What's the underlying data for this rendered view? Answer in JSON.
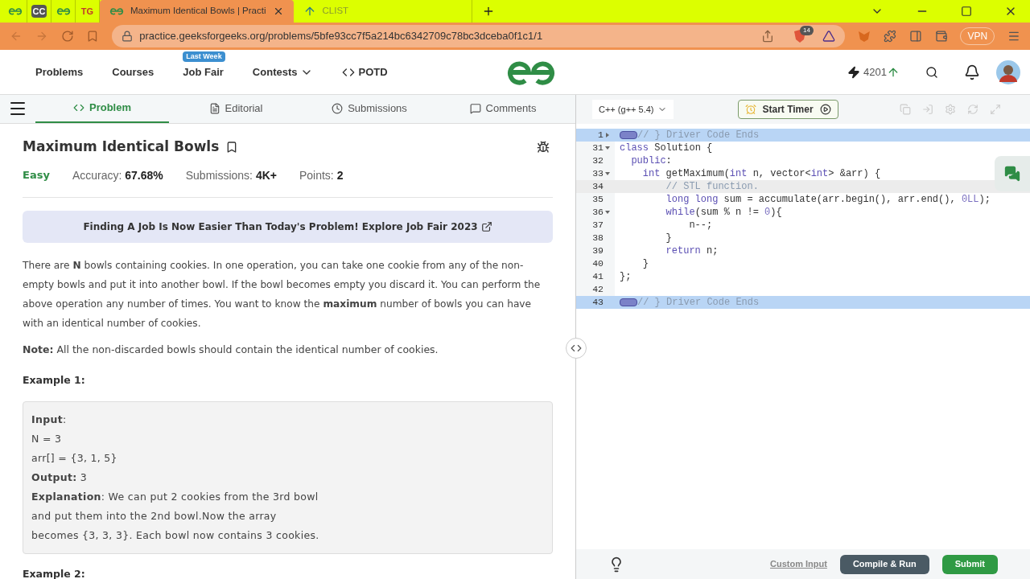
{
  "browser": {
    "tabs": [
      {
        "kind": "gfg",
        "selected": false
      },
      {
        "kind": "text",
        "label": "CC",
        "selected": false
      },
      {
        "kind": "gfg",
        "selected": false
      },
      {
        "kind": "text",
        "label": "TG",
        "selected": false
      },
      {
        "kind": "gfg",
        "label": "Maximum Identical Bowls | Practi",
        "selected": true
      },
      {
        "kind": "clist",
        "label": "CLIST",
        "selected": false
      }
    ],
    "url": "practice.geeksforgeeks.org/problems/5bfe93cc7f5a214bc6342709c78bc3dceba0f1c1/1",
    "shield_count": "14",
    "vpn": "VPN"
  },
  "nav": {
    "items": [
      {
        "label": "Problems",
        "dropdown": false
      },
      {
        "label": "Courses",
        "dropdown": false
      },
      {
        "label": "Job Fair",
        "badge": "Last Week",
        "dropdown": false
      },
      {
        "label": "Contests",
        "dropdown": true
      },
      {
        "label": "POTD",
        "dropdown": false
      }
    ],
    "streak": "4201"
  },
  "problem_tabs": [
    {
      "label": "Problem",
      "selected": true
    },
    {
      "label": "Editorial",
      "selected": false
    },
    {
      "label": "Submissions",
      "selected": false
    },
    {
      "label": "Comments",
      "selected": false
    }
  ],
  "problem": {
    "title": "Maximum Identical Bowls",
    "difficulty": "Easy",
    "stats": [
      {
        "label": "Accuracy:",
        "value": "67.68%"
      },
      {
        "label": "Submissions:",
        "value": "4K+"
      },
      {
        "label": "Points:",
        "value": "2"
      }
    ],
    "banner": "Finding A Job Is Now Easier Than Today's Problem! Explore Job Fair 2023",
    "description": "There are **N** bowls containing cookies. In one operation, you can take one cookie from any of the non-empty bowls and put it into another bowl. If the bowl becomes empty you discard it. You can perform the above operation any number of times. You want to know the **maximum** number of bowls you can have with an identical number of cookies.",
    "note": "**Note:** All the non-discarded bowls should contain the identical number of cookies.",
    "example_titles": [
      "Example 1:",
      "Example 2:"
    ],
    "example_lines": [
      "**Input**:",
      "N = 3",
      "arr[] = {3, 1, 5}",
      "**Output:** 3",
      "**Explanation**: We can put 2 cookies from the 3rd bowl",
      "and put them into the 2nd bowl.Now the array",
      "becomes {3, 3, 3}. Each bowl now contains 3 cookies."
    ]
  },
  "editor": {
    "language": "C++ (g++ 5.4)",
    "timer": "Start Timer",
    "lines": [
      {
        "number": "1",
        "folded": true,
        "selected": true,
        "current": false,
        "tokens": [
          {
            "kind": "marker"
          },
          {
            "kind": "comment",
            "t": "// } Driver Code Ends"
          }
        ]
      },
      {
        "number": "31",
        "folded": false,
        "selected": false,
        "current": false,
        "tokens": [
          {
            "kind": "keyword",
            "t": "class"
          },
          {
            "kind": "plain",
            "t": " Solution {"
          }
        ]
      },
      {
        "number": "32",
        "selected": false,
        "current": false,
        "tokens": [
          {
            "kind": "keyword",
            "t": "  public"
          },
          {
            "kind": "plain",
            "t": ":"
          }
        ]
      },
      {
        "number": "33",
        "folded": false,
        "selected": false,
        "current": false,
        "tokens": [
          {
            "kind": "keyword",
            "t": "    int"
          },
          {
            "kind": "plain",
            "t": " getMaximum("
          },
          {
            "kind": "keyword",
            "t": "int"
          },
          {
            "kind": "plain",
            "t": " n, vector<"
          },
          {
            "kind": "keyword",
            "t": "int"
          },
          {
            "kind": "plain",
            "t": "> &arr) {"
          }
        ]
      },
      {
        "number": "34",
        "selected": false,
        "current": true,
        "tokens": [
          {
            "kind": "comment",
            "t": "        // STL function."
          }
        ]
      },
      {
        "number": "35",
        "selected": false,
        "current": false,
        "tokens": [
          {
            "kind": "keyword",
            "t": "        long long"
          },
          {
            "kind": "plain",
            "t": " sum = accumulate(arr.begin(), arr.end(), "
          },
          {
            "kind": "number",
            "t": "0LL"
          },
          {
            "kind": "plain",
            "t": ");"
          }
        ]
      },
      {
        "number": "36",
        "folded": false,
        "selected": false,
        "current": false,
        "tokens": [
          {
            "kind": "keyword",
            "t": "        while"
          },
          {
            "kind": "plain",
            "t": "(sum % n != "
          },
          {
            "kind": "number",
            "t": "0"
          },
          {
            "kind": "plain",
            "t": "){"
          }
        ]
      },
      {
        "number": "37",
        "selected": false,
        "current": false,
        "tokens": [
          {
            "kind": "plain",
            "t": "            n--;"
          }
        ]
      },
      {
        "number": "38",
        "selected": false,
        "current": false,
        "tokens": [
          {
            "kind": "plain",
            "t": "        }"
          }
        ]
      },
      {
        "number": "39",
        "selected": false,
        "current": false,
        "tokens": [
          {
            "kind": "keyword",
            "t": "        return"
          },
          {
            "kind": "plain",
            "t": " n;"
          }
        ]
      },
      {
        "number": "40",
        "selected": false,
        "current": false,
        "tokens": [
          {
            "kind": "plain",
            "t": "    }"
          }
        ]
      },
      {
        "number": "41",
        "selected": false,
        "current": false,
        "tokens": [
          {
            "kind": "plain",
            "t": "};"
          }
        ]
      },
      {
        "number": "42",
        "selected": false,
        "current": false
      },
      {
        "number": "43",
        "selected": true,
        "current": false,
        "tokens": [
          {
            "kind": "marker"
          },
          {
            "kind": "comment",
            "t": "// } Driver Code Ends"
          }
        ]
      }
    ],
    "custom_input": "Custom Input",
    "run": "Compile & Run",
    "submit": "Submit"
  }
}
